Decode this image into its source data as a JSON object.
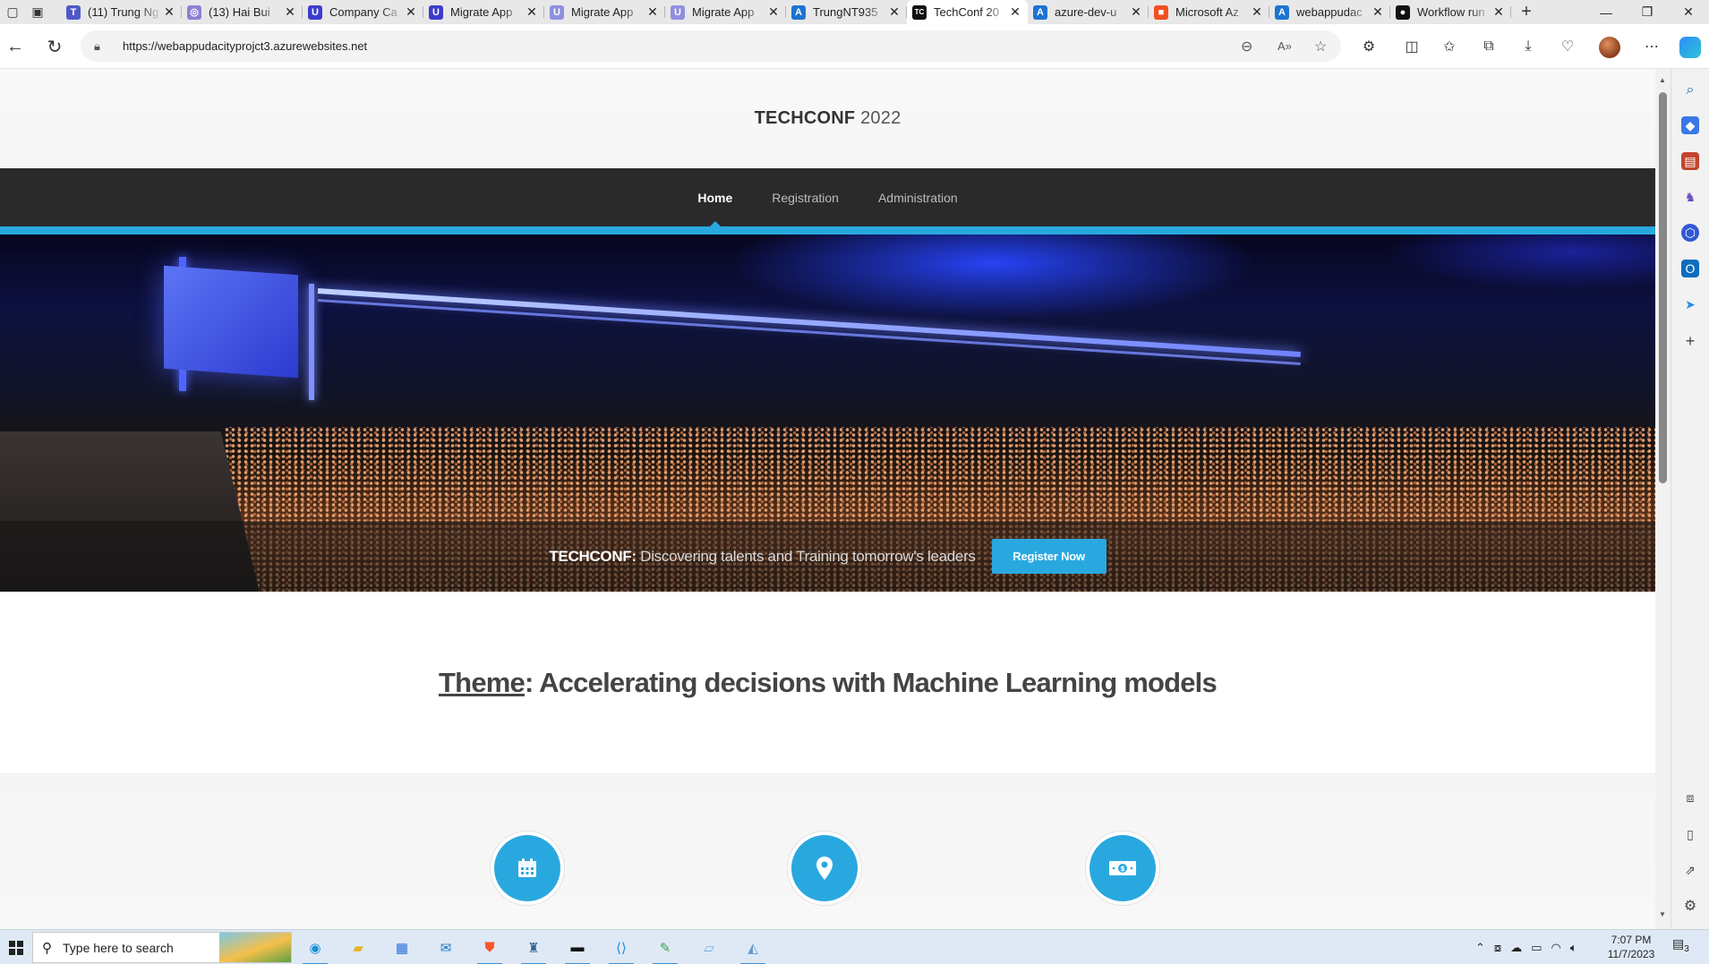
{
  "browser": {
    "tabs": [
      {
        "title": "(11) Trung Ng",
        "favicon": "teams-icon",
        "color": "#5059c9",
        "glyph": "T"
      },
      {
        "title": "(13) Hai Bui",
        "favicon": "messenger-icon",
        "color": "#8f7fd4",
        "glyph": "◎"
      },
      {
        "title": "Company Ca",
        "favicon": "udacity-icon",
        "color": "#3d3dcc",
        "glyph": "U"
      },
      {
        "title": "Migrate App",
        "favicon": "udacity-icon",
        "color": "#3d3dcc",
        "glyph": "U"
      },
      {
        "title": "Migrate App",
        "favicon": "udacity-icon",
        "color": "#8f8fe0",
        "glyph": "U"
      },
      {
        "title": "Migrate App",
        "favicon": "udacity-icon",
        "color": "#8f8fe0",
        "glyph": "U"
      },
      {
        "title": "TrungNT935",
        "favicon": "azure-icon",
        "color": "#1c74d1",
        "glyph": "A"
      },
      {
        "title": "TechConf 20",
        "favicon": "techconf-icon",
        "color": "#111111",
        "glyph": "TC",
        "active": true
      },
      {
        "title": "azure-dev-u",
        "favicon": "azure-icon",
        "color": "#1c74d1",
        "glyph": "A"
      },
      {
        "title": "Microsoft Az",
        "favicon": "microsoft-icon",
        "color": "#f25022",
        "glyph": "■"
      },
      {
        "title": "webappudac",
        "favicon": "azure-icon",
        "color": "#1c74d1",
        "glyph": "A"
      },
      {
        "title": "Workflow run",
        "favicon": "github-icon",
        "color": "#111111",
        "glyph": "●"
      }
    ],
    "url": "https://webappudacityprojct3.azurewebsites.net"
  },
  "site": {
    "logo_strong": "TECHCONF",
    "logo_year": "2022",
    "nav": [
      {
        "label": "Home",
        "active": true
      },
      {
        "label": "Registration",
        "active": false
      },
      {
        "label": "Administration",
        "active": false
      }
    ],
    "hero": {
      "tagline_strong": "TECHCONF:",
      "tagline_rest": "Discovering talents and Training tomorrow's leaders",
      "cta_label": "Register Now"
    },
    "theme": {
      "label": "Theme",
      "text": ": Accelerating decisions with Machine Learning models"
    },
    "features": [
      {
        "icon": "calendar-icon"
      },
      {
        "icon": "location-pin-icon"
      },
      {
        "icon": "money-icon"
      }
    ],
    "accent_color": "#29a8e0"
  },
  "taskbar": {
    "search_placeholder": "Type here to search",
    "time": "7:07 PM",
    "date": "11/7/2023",
    "notification_count": "3"
  }
}
